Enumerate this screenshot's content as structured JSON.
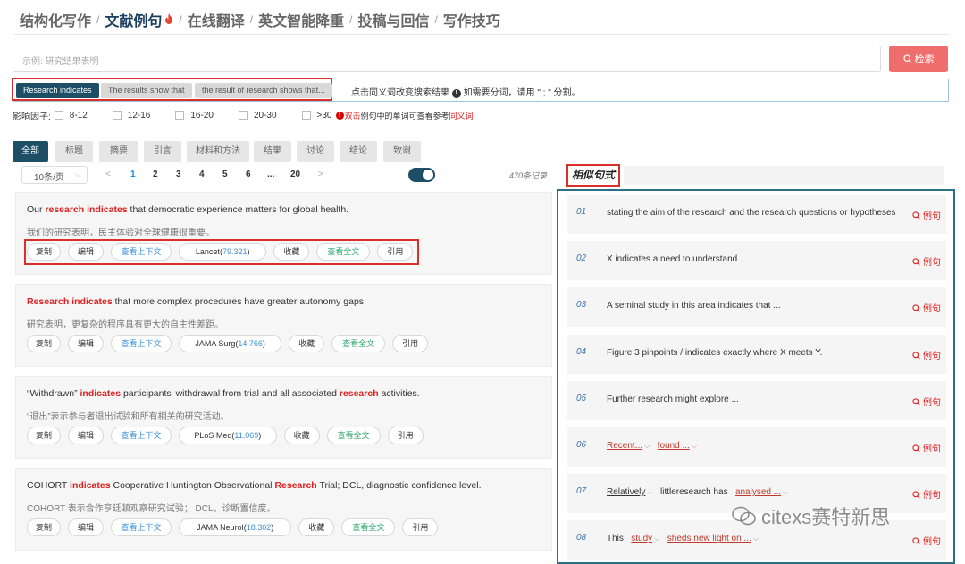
{
  "nav": {
    "items": [
      "结构化写作",
      "文献例句",
      "在线翻译",
      "英文智能降重",
      "投稿与回信",
      "写作技巧"
    ],
    "active_index": 1,
    "separator": "/"
  },
  "search": {
    "placeholder": "示例: 研究结果表明",
    "button_label": "检索"
  },
  "synonyms": {
    "chips": [
      "Research indicates",
      "The results show that",
      "the result of research shows that..."
    ],
    "hint": "点击同义词改变搜索结果",
    "hint2": "如需要分词，请用 \" ; \" 分割。"
  },
  "impact": {
    "label": "影响因子:",
    "options": [
      "8-12",
      "12-16",
      "16-20",
      "20-30",
      ">30"
    ],
    "note_pre": "双击",
    "note_mid": "例句中的单词可查看参考",
    "note_red": "同义词"
  },
  "tabs": [
    "全部",
    "标题",
    "摘要",
    "引言",
    "材料和方法",
    "结果",
    "讨论",
    "结论",
    "致谢"
  ],
  "pagination": {
    "per_page": "10条/页",
    "prev": "<",
    "next": ">",
    "pages": [
      "1",
      "2",
      "3",
      "4",
      "5",
      "6",
      "...",
      "20"
    ],
    "current": "1",
    "records": "470条记录"
  },
  "results": [
    {
      "en": [
        [
          "Our ",
          false
        ],
        [
          "research indicates",
          true
        ],
        [
          " that democratic experience matters for global health.",
          false
        ]
      ],
      "zh": "我们的研究表明，民主体验对全球健康很重要。",
      "journal": "Lancet",
      "if": "79.321"
    },
    {
      "en": [
        [
          "Research indicates",
          true
        ],
        [
          " that more complex procedures have greater autonomy gaps.",
          false
        ]
      ],
      "zh": "研究表明，更复杂的程序具有更大的自主性差距。",
      "journal": "JAMA Surg",
      "if": "14.766"
    },
    {
      "en": [
        [
          "“Withdrawn” ",
          false
        ],
        [
          "indicates",
          true
        ],
        [
          " participants' withdrawal from trial and all associated ",
          false
        ],
        [
          "research",
          true
        ],
        [
          " activities.",
          false
        ]
      ],
      "zh": "“退出”表示参与者退出试验和所有相关的研究活动。",
      "journal": "PLoS Med",
      "if": "11.069"
    },
    {
      "en": [
        [
          "COHORT ",
          false
        ],
        [
          "indicates",
          true
        ],
        [
          " Cooperative Huntington Observational ",
          false
        ],
        [
          "Research",
          true
        ],
        [
          " Trial; DCL, diagnostic confidence level.",
          false
        ]
      ],
      "zh": "COHORT 表示合作亨廷顿观察研究试验； DCL，诊断置信度。",
      "journal": "JAMA Neurol",
      "if": "18.302"
    }
  ],
  "result_buttons": {
    "copy": "复制",
    "edit": "编辑",
    "context": "查看上下文",
    "collect": "收藏",
    "fulltext": "查看全文",
    "cite": "引用"
  },
  "similar": {
    "title": "相似句式",
    "example_label": "例句",
    "items": [
      {
        "no": "01",
        "text": "stating the aim of the research and the research questions or hypotheses"
      },
      {
        "no": "02",
        "text": "X indicates a need to understand ..."
      },
      {
        "no": "03",
        "text": "A seminal study in this area indicates that ..."
      },
      {
        "no": "04",
        "text": "Figure 3 pinpoints / indicates exactly where X meets Y."
      },
      {
        "no": "05",
        "text": "Further research might explore ..."
      },
      {
        "no": "06",
        "parts": [
          {
            "t": "Recent...",
            "u": true
          },
          {
            "t": "found ...",
            "u": true
          }
        ]
      },
      {
        "no": "07",
        "parts": [
          {
            "t": "Relatively",
            "u": true,
            "k": true
          },
          {
            "t": "littleresearch has",
            "u": false
          },
          {
            "t": "analysed ...",
            "u": true
          }
        ]
      },
      {
        "no": "08",
        "parts": [
          {
            "t": "This",
            "u": false
          },
          {
            "t": "study",
            "u": true
          },
          {
            "t": "sheds new light on ...",
            "u": true
          }
        ]
      }
    ]
  },
  "watermark": "citexs赛特新思"
}
